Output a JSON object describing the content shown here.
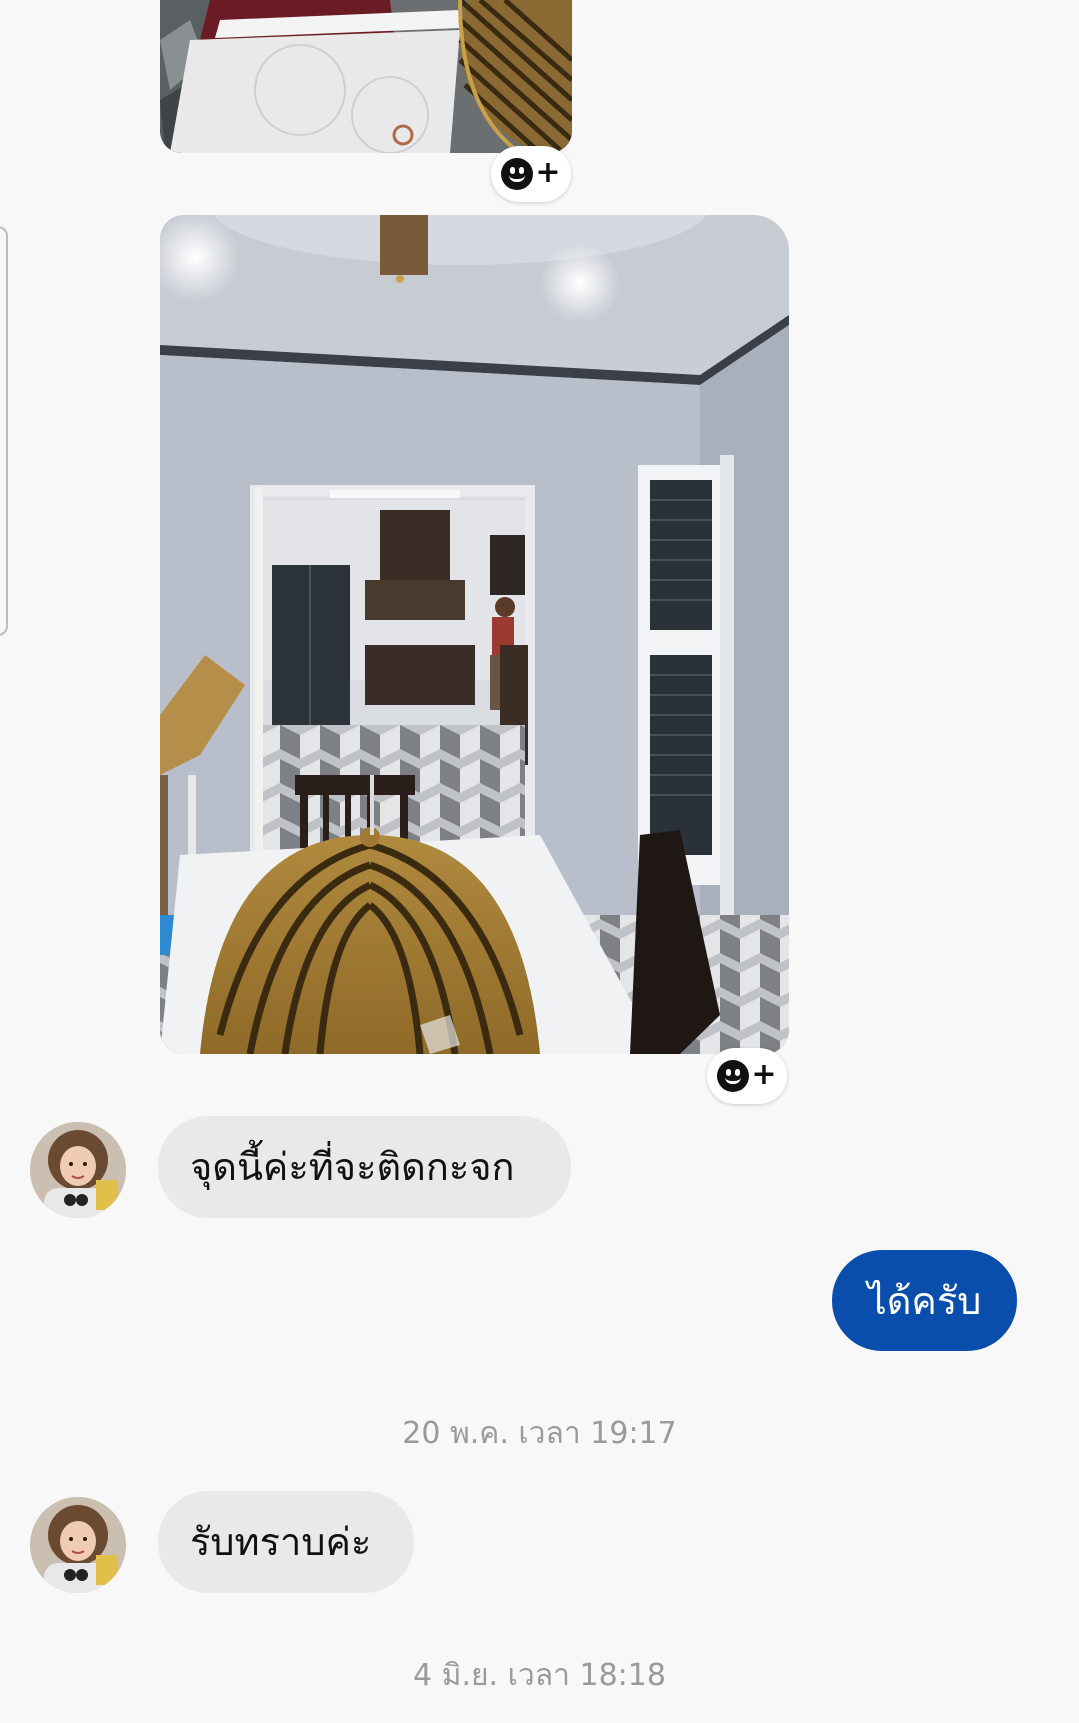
{
  "conversation": {
    "messages": [
      {
        "sender": "other",
        "type": "image",
        "content": "photo-dining-table-closeup"
      },
      {
        "sender": "other",
        "type": "image",
        "content": "photo-dining-room-kitchen"
      },
      {
        "sender": "other",
        "type": "text",
        "text": "จุดนี้ค่ะที่จะติดกะจก"
      },
      {
        "sender": "me",
        "type": "text",
        "text": "ได้ครับ"
      },
      {
        "sender": "other",
        "type": "text",
        "text": "รับทราบค่ะ"
      }
    ],
    "timestamps": [
      "20 พ.ค. เวลา 19:17",
      "4 มิ.ย. เวลา 18:18"
    ]
  },
  "icons": {
    "reaction": "add-reaction-icon",
    "avatar": "contact-avatar"
  },
  "colors": {
    "background": "#f8f8f8",
    "incoming_bubble": "#e9e9e9",
    "outgoing_bubble": "#0a4ead",
    "timestamp_text": "#9a9a9a"
  }
}
